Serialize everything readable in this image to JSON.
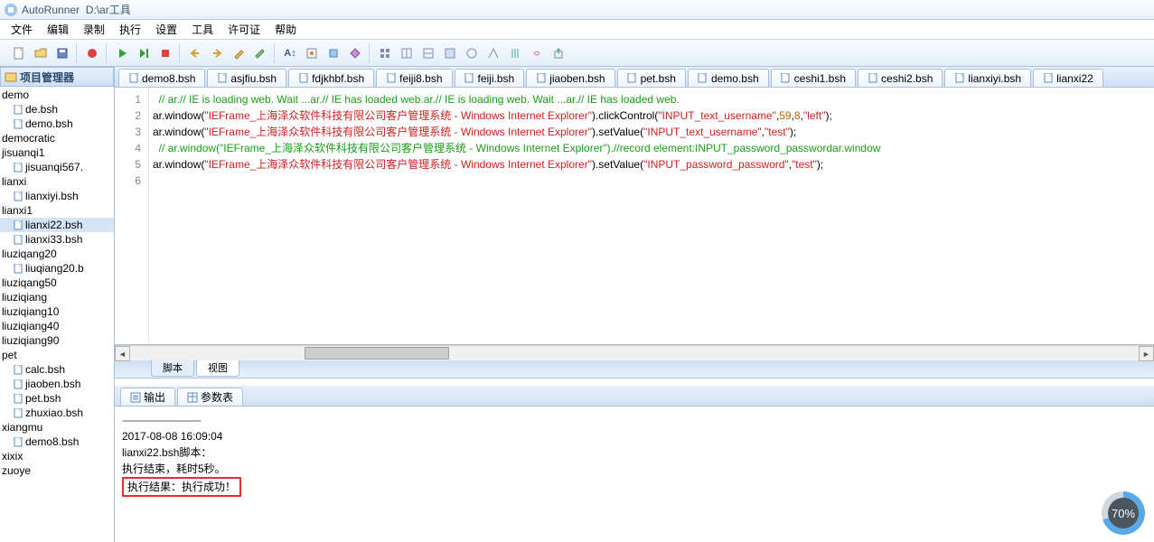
{
  "title_prefix": "AutoRunner",
  "title_path": "D:\\ar工具",
  "menu": [
    "文件",
    "编辑",
    "录制",
    "执行",
    "设置",
    "工具",
    "许可证",
    "帮助"
  ],
  "project_panel_title": "项目管理器",
  "tree": [
    {
      "t": "folder",
      "label": "demo"
    },
    {
      "t": "file",
      "label": "de.bsh"
    },
    {
      "t": "file",
      "label": "demo.bsh"
    },
    {
      "t": "folder",
      "label": "democratic"
    },
    {
      "t": "folder",
      "label": "jisuanqi1"
    },
    {
      "t": "file",
      "label": "jisuanqi567."
    },
    {
      "t": "folder",
      "label": "lianxi"
    },
    {
      "t": "file",
      "label": "lianxiyi.bsh"
    },
    {
      "t": "folder",
      "label": "lianxi1"
    },
    {
      "t": "file",
      "label": "lianxi22.bsh",
      "selected": true
    },
    {
      "t": "file",
      "label": "lianxi33.bsh"
    },
    {
      "t": "folder",
      "label": "liuziqang20"
    },
    {
      "t": "file",
      "label": "liuqiang20.b"
    },
    {
      "t": "folder",
      "label": "liuziqang50"
    },
    {
      "t": "folder",
      "label": "liuziqiang"
    },
    {
      "t": "folder",
      "label": "liuziqiang10"
    },
    {
      "t": "folder",
      "label": "liuziqiang40"
    },
    {
      "t": "folder",
      "label": "liuziqiang90"
    },
    {
      "t": "folder",
      "label": "pet"
    },
    {
      "t": "file",
      "label": "calc.bsh"
    },
    {
      "t": "file",
      "label": "jiaoben.bsh"
    },
    {
      "t": "file",
      "label": "pet.bsh"
    },
    {
      "t": "file",
      "label": "zhuxiao.bsh"
    },
    {
      "t": "folder",
      "label": "xiangmu"
    },
    {
      "t": "file",
      "label": "demo8.bsh"
    },
    {
      "t": "folder",
      "label": "xixix"
    },
    {
      "t": "folder",
      "label": "zuoye"
    }
  ],
  "tabs": [
    "demo8.bsh",
    "asjfiu.bsh",
    "fdjkhbf.bsh",
    "feiji8.bsh",
    "feiji.bsh",
    "jiaoben.bsh",
    "pet.bsh",
    "demo.bsh",
    "ceshi1.bsh",
    "ceshi2.bsh",
    "lianxiyi.bsh",
    "lianxi22"
  ],
  "code": {
    "l1": "  // ar.// IE is loading web. Wait ...ar.// IE has loaded web.ar.// IE is loading web. Wait ...ar.// IE has loaded web.",
    "l2a": "ar.window(",
    "l2s": "\"IEFrame_上海泽众软件科技有限公司客户管理系统 - Windows Internet Explorer\"",
    "l2b": ").clickControl(",
    "l2s2": "\"INPUT_text_username\"",
    "l2c": ",",
    "l2n1": "59",
    "l2c2": ",",
    "l2n2": "8",
    "l2c3": ",",
    "l2s3": "\"left\"",
    "l2d": ");",
    "l3a": "ar.window(",
    "l3s": "\"IEFrame_上海泽众软件科技有限公司客户管理系统 - Windows Internet Explorer\"",
    "l3b": ").setValue(",
    "l3s2": "\"INPUT_text_username\"",
    "l3c": ",",
    "l3s3": "\"test\"",
    "l3d": ");",
    "l4": "  // ar.window(\"IEFrame_上海泽众软件科技有限公司客户管理系统 - Windows Internet Explorer\").//record element:INPUT_password_passwordar.window",
    "l5a": "ar.window(",
    "l5s": "\"IEFrame_上海泽众软件科技有限公司客户管理系统 - Windows Internet Explorer\"",
    "l5b": ").setValue(",
    "l5s2": "\"INPUT_password_password\"",
    "l5c": ",",
    "l5s3": "\"test\"",
    "l5d": ");"
  },
  "line_numbers": [
    "1",
    "2",
    "3",
    "4",
    "5",
    "6"
  ],
  "view_tabs": {
    "script": "脚本",
    "view": "视图"
  },
  "bottom": {
    "output": "输出",
    "params": "参数表"
  },
  "console": {
    "sep": "-----------------------------",
    "ts": "2017-08-08 16:09:04",
    "line1": "lianxi22.bsh脚本：",
    "line2": "执行结束，耗时5秒。",
    "result": "执行结果：执行成功！"
  },
  "progress": "70%"
}
